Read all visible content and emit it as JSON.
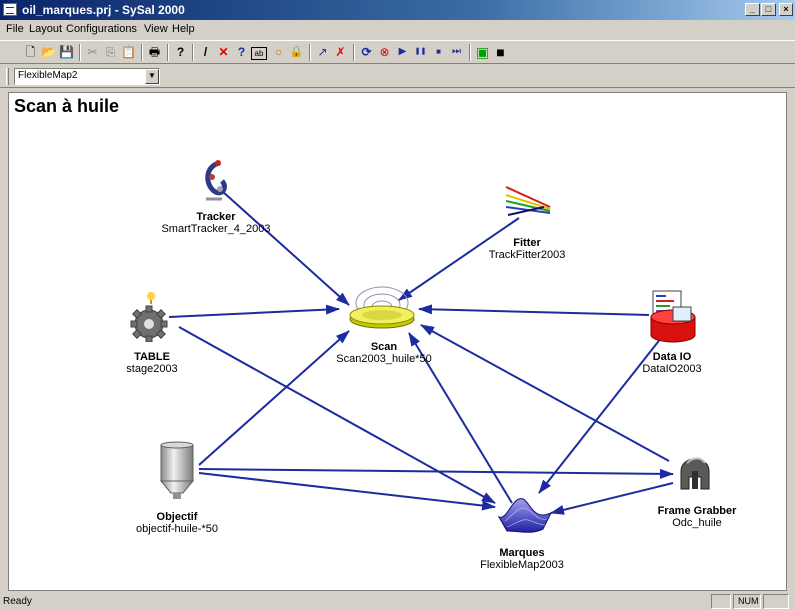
{
  "window": {
    "title": "oil_marques.prj - SySal 2000",
    "min": "_",
    "max": "□",
    "close": "×"
  },
  "menu": [
    "File",
    "Layout",
    "Configurations",
    "View",
    "Help"
  ],
  "toolbar": [
    {
      "name": "new-icon",
      "glyph": "🗋"
    },
    {
      "name": "open-icon",
      "glyph": "📂"
    },
    {
      "name": "save-icon",
      "glyph": "💾"
    },
    {
      "name": "cut-icon",
      "glyph": "✂"
    },
    {
      "name": "copy-icon",
      "glyph": "⎘"
    },
    {
      "name": "paste-icon",
      "glyph": "📋"
    },
    {
      "name": "print-icon",
      "glyph": "🖶"
    },
    {
      "name": "help-icon",
      "glyph": "?"
    },
    {
      "name": "pencil-icon",
      "glyph": "/"
    },
    {
      "name": "delete-icon",
      "glyph": "✕"
    },
    {
      "name": "whats-this-icon",
      "glyph": "?"
    },
    {
      "name": "label-icon",
      "glyph": "ab"
    },
    {
      "name": "shape-icon",
      "glyph": "○"
    },
    {
      "name": "lock-icon",
      "glyph": "🔒"
    },
    {
      "name": "connect-icon",
      "glyph": "↗"
    },
    {
      "name": "disconnect-icon",
      "glyph": "✗"
    },
    {
      "name": "refresh-icon",
      "glyph": "⟳"
    },
    {
      "name": "stop-target-icon",
      "glyph": "⊗"
    },
    {
      "name": "play-icon",
      "glyph": "▶"
    },
    {
      "name": "pause-icon",
      "glyph": "❚❚"
    },
    {
      "name": "stop-icon",
      "glyph": "■"
    },
    {
      "name": "step-icon",
      "glyph": "⏭"
    },
    {
      "name": "green-box-icon",
      "glyph": "▣"
    },
    {
      "name": "black-box-icon",
      "glyph": "■"
    }
  ],
  "layout_select": "FlexibleMap2",
  "canvas_title": "Scan à huile",
  "nodes": {
    "tracker": {
      "name": "Tracker",
      "type": "SmartTracker_4_2003"
    },
    "fitter": {
      "name": "Fitter",
      "type": "TrackFitter2003"
    },
    "table": {
      "name": "TABLE",
      "type": "stage2003"
    },
    "scan": {
      "name": "Scan",
      "type": "Scan2003_huile*50"
    },
    "dataio": {
      "name": "Data IO",
      "type": "DataIO2003"
    },
    "objectif": {
      "name": "Objectif",
      "type": "objectif-huile-*50"
    },
    "framegrabber": {
      "name": "Frame Grabber",
      "type": "Odc_huile"
    },
    "marques": {
      "name": "Marques",
      "type": "FlexibleMap2003"
    }
  },
  "colors": {
    "link": "#1c2ba0",
    "canvas": "#ffffff",
    "titlebar": "#0a246a"
  },
  "status": {
    "text": "Ready",
    "num": "NUM"
  }
}
